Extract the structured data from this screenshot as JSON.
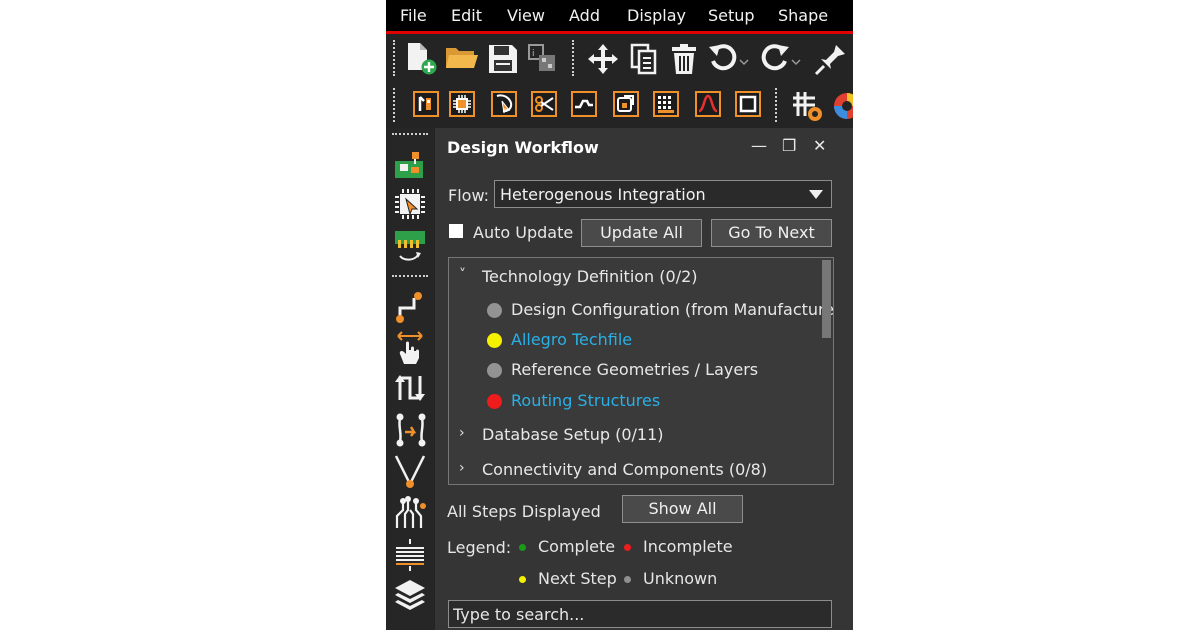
{
  "menu": [
    "File",
    "Edit",
    "View",
    "Add",
    "Display",
    "Setup",
    "Shape"
  ],
  "panel": {
    "title": "Design Workflow",
    "minimize_glyph": "—",
    "restore_glyph": "❐",
    "close_glyph": "✕",
    "flow_label": "Flow:",
    "flow_value": "Heterogenous Integration",
    "auto_update_label": "Auto Update",
    "update_all_label": "Update All",
    "go_to_next_label": "Go To Next",
    "tree": [
      {
        "label": "Technology Definition  (0/2)",
        "expanded": true
      },
      {
        "label": "Design Configuration (from Manufacture",
        "status": "unknown"
      },
      {
        "label": "Allegro Techfile",
        "status": "next-step"
      },
      {
        "label": "Reference Geometries / Layers",
        "status": "unknown"
      },
      {
        "label": "Routing Structures",
        "status": "incomplete"
      },
      {
        "label": "Database Setup  (0/11)",
        "expanded": false
      },
      {
        "label": "Connectivity and Components  (0/8)",
        "expanded": false
      }
    ],
    "steps_displayed": "All Steps Displayed",
    "show_all_label": "Show All",
    "legend_label": "Legend:",
    "legend": [
      {
        "label": "Complete",
        "color": "#1a9a1a"
      },
      {
        "label": "Incomplete",
        "color": "#ee1c1c"
      },
      {
        "label": "Next Step",
        "color": "#f4f000"
      },
      {
        "label": "Unknown",
        "color": "#909090"
      }
    ],
    "search_placeholder": "Type to search..."
  },
  "colors": {
    "accent_orange": "#f0902a",
    "link_blue": "#2ab0e6",
    "menu_red": "#e00000"
  },
  "icons": {
    "toolbar1": [
      "new-file-icon",
      "open-folder-icon",
      "save-icon",
      "export-icon",
      "move-icon",
      "copy-icon",
      "delete-icon",
      "undo-icon",
      "redo-icon",
      "pin-icon"
    ],
    "toolbar2": [
      "place-icon",
      "component-icon",
      "select-icon",
      "cut-icon",
      "route-icon",
      "shape-icon",
      "grid-array-icon",
      "curve-icon",
      "square-icon",
      "grid-icon",
      "color-wheel-icon"
    ],
    "sidebar": [
      "board-icon",
      "chip-select-icon",
      "connector-icon",
      "route-node-icon",
      "hand-icon",
      "swap-icon",
      "path-icon",
      "v-route-icon",
      "fanout-icon",
      "bus-icon",
      "layers-icon"
    ]
  }
}
